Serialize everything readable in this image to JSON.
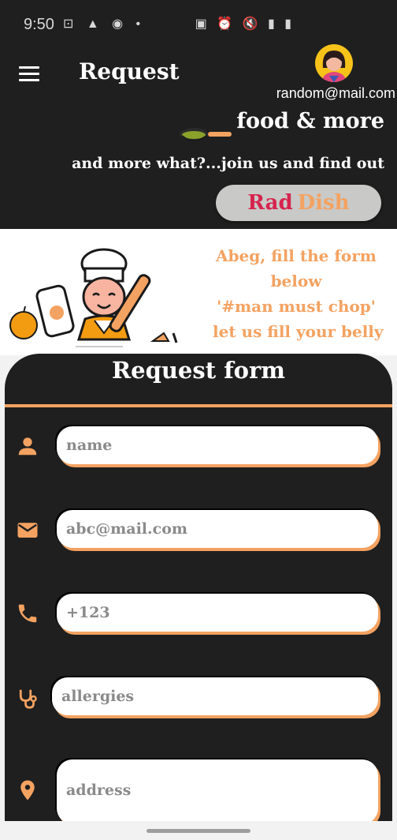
{
  "status_bar": {
    "time": "9:50",
    "left_icons": "⊡ ▲ ◉ •",
    "right_icons": "▣ ⏰ 🔇 ▮ ▮"
  },
  "app_bar": {
    "title": "Request",
    "menu_icon": "hamburger-menu-icon",
    "account_email": "random@mail.com"
  },
  "banner": {
    "line1": "food & more",
    "line2": "and more what?...join us and find out",
    "brand_rad": "Rad",
    "brand_dish": "Dish"
  },
  "hero": {
    "lines": [
      "Abeg, fill the form",
      "below",
      "'#man must chop'",
      "let us fill your belly"
    ]
  },
  "form": {
    "title": "Request form",
    "fields": {
      "name": {
        "placeholder": "name",
        "icon": "person-icon"
      },
      "email": {
        "placeholder": "abc@mail.com",
        "icon": "mail-icon"
      },
      "phone": {
        "placeholder": "+123",
        "icon": "phone-icon"
      },
      "allergies": {
        "placeholder": "allergies",
        "icon": "stethoscope-icon"
      },
      "address": {
        "placeholder": "address",
        "icon": "location-pin-icon"
      }
    }
  },
  "colors": {
    "dark": "#1f1f1f",
    "accent": "#f4a261",
    "brand_red": "#d6244e",
    "avatar_bg": "#f7c21a"
  }
}
